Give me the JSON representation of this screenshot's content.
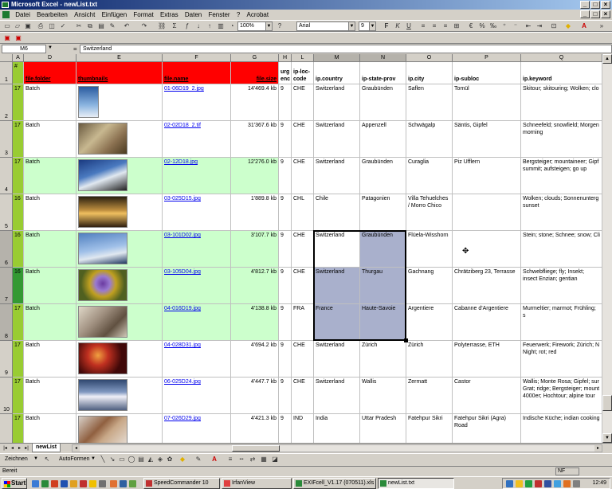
{
  "window": {
    "title": "Microsoft Excel - newList.txt"
  },
  "menu": [
    "Datei",
    "Bearbeiten",
    "Ansicht",
    "Einfügen",
    "Format",
    "Extras",
    "Daten",
    "Fenster",
    "?",
    "Acrobat"
  ],
  "toolbar": {
    "zoom": "100%",
    "font": "Arial",
    "size": "9"
  },
  "formula": {
    "cell_ref": "M6",
    "eq": "=",
    "value": "Switzerland"
  },
  "columns": [
    {
      "id": "A",
      "label": "A"
    },
    {
      "id": "D",
      "label": "D"
    },
    {
      "id": "E",
      "label": "E"
    },
    {
      "id": "F",
      "label": "F"
    },
    {
      "id": "G",
      "label": "G"
    },
    {
      "id": "H",
      "label": "H"
    },
    {
      "id": "L",
      "label": "L"
    },
    {
      "id": "M",
      "label": "M"
    },
    {
      "id": "N",
      "label": "N"
    },
    {
      "id": "O",
      "label": "O"
    },
    {
      "id": "P",
      "label": "P"
    },
    {
      "id": "Q",
      "label": "Q"
    }
  ],
  "header_row": {
    "row_num": "1",
    "a": "#",
    "d": "file.folder",
    "e": "thumbnails",
    "f": "file.name",
    "g": "file.size",
    "h": "urg enc",
    "l": "ip-loc-code",
    "m": "ip.country",
    "n": "ip-state-prov",
    "o": "ip.city",
    "p": "ip-subloc",
    "q": "ip.keyword"
  },
  "rows": [
    {
      "num": "2",
      "a": "17",
      "d": "Batch",
      "f": "01-06D19_2.jpg",
      "g": "14'469.4 kb",
      "h": "9",
      "l": "CHE",
      "m": "Switzerland",
      "n": "Graubünden",
      "o": "Saflen",
      "p": "Tomül",
      "q": "Skitour; skitouring; Wolken; clo"
    },
    {
      "num": "3",
      "a": "17",
      "d": "Batch",
      "f": "02-02D18_2.tif",
      "g": "31'367.6 kb",
      "h": "9",
      "l": "CHE",
      "m": "Switzerland",
      "n": "Appenzell",
      "o": "Schwägalp",
      "p": "Säntis, Gipfel",
      "q": "Schneefeld; snowfield; Morgen morning"
    },
    {
      "num": "4",
      "a": "17",
      "d": "Batch",
      "f": "02-12D18.jpg",
      "g": "12'276.0 kb",
      "h": "9",
      "l": "CHE",
      "m": "Switzerland",
      "n": "Graubünden",
      "o": "Curaglia",
      "p": "Piz Ufflern",
      "q": "Bergsteiger; mountaineer; Gipf summit; aufsteigen; go up"
    },
    {
      "num": "5",
      "a": "16",
      "d": "Batch",
      "f": "03-025D15.jpg",
      "g": "1'889.8 kb",
      "h": "9",
      "l": "CHL",
      "m": "Chile",
      "n": "Patagonien",
      "o": "Villa Tehuelches / Morro Chico",
      "p": "",
      "q": "Wolken; clouds; Sonnenunterg sunset"
    },
    {
      "num": "6",
      "a": "16",
      "d": "Batch",
      "f": "03-101D02.jpg",
      "g": "3'107.7 kb",
      "h": "9",
      "l": "CHE",
      "m": "Switzerland",
      "n": "Graubünden",
      "o": "Flüela-Wisshorn",
      "p": "",
      "q": "Stein; stone; Schnee; snow; Cli"
    },
    {
      "num": "7",
      "a": "16",
      "d": "Batch",
      "f": "03-105D04.jpg",
      "g": "4'812.7 kb",
      "h": "9",
      "l": "CHE",
      "m": "Switzerland",
      "n": "Thurgau",
      "o": "Gachnang",
      "p": "Chrätziberg 23, Terrasse",
      "q": "Schwebfliege; fly; Insekt; insect Enzian; gentian"
    },
    {
      "num": "8",
      "a": "17",
      "d": "Batch",
      "f": "04-016D19.jpg",
      "g": "4'138.8 kb",
      "h": "9",
      "l": "FRA",
      "m": "France",
      "n": "Haute-Savoie",
      "o": "Argentiere",
      "p": "Cabanne d'Argentiere",
      "q": "Murmeltier; marmot; Frühling; s"
    },
    {
      "num": "9",
      "a": "17",
      "d": "Batch",
      "f": "04-028D31.jpg",
      "g": "4'694.2 kb",
      "h": "9",
      "l": "CHE",
      "m": "Switzerland",
      "n": "Zürich",
      "o": "Zürich",
      "p": "Polyterrasse, ETH",
      "q": "Feuerwerk; Firework; Zürich; N Night; rot; red"
    },
    {
      "num": "10",
      "a": "17",
      "d": "Batch",
      "f": "06-025D24.jpg",
      "g": "4'447.7 kb",
      "h": "9",
      "l": "CHE",
      "m": "Switzerland",
      "n": "Wallis",
      "o": "Zermatt",
      "p": "Castor",
      "q": "Wallis; Monte Rosa; Gipfel; sur Grat; ridge; Bergsteiger; mount 4000er; Hochtour; alpine tour"
    },
    {
      "num": "11",
      "a": "17",
      "d": "Batch",
      "f": "07-026D29.jpg",
      "g": "4'421.3 kb",
      "h": "9",
      "l": "IND",
      "m": "India",
      "n": "Uttar Pradesh",
      "o": "Fatehpur Sikri",
      "p": "Fatehpur Sikri (Agra) Road",
      "q": "Indische Küche; indian cooking"
    }
  ],
  "last_row_num": "12",
  "sheet_tab": "newList",
  "drawbar": {
    "draw": "Zeichnen",
    "autoshapes": "AutoFormen"
  },
  "status": {
    "text": "Bereit",
    "nf": "NF"
  },
  "taskbar": {
    "start": "Start",
    "tasks": [
      "SpeedCommander 10",
      "IrfanView",
      "EXIFcell_V1.17 (070511).xls",
      "newList.txt"
    ],
    "clock": "12:49"
  },
  "colors": {
    "header_red": "#ff0000",
    "row_green": "#ccffcc",
    "selection": "#a9b0cc",
    "titlebar": "#0a246a"
  }
}
